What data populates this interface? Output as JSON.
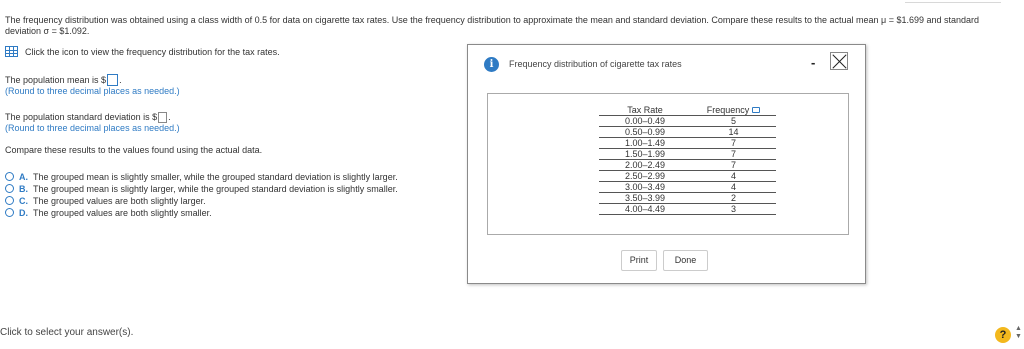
{
  "question": {
    "text": "The frequency distribution was obtained using a class width of 0.5 for data on cigarette tax rates. Use the frequency distribution to approximate the mean and standard deviation. Compare these results to the actual mean μ = $1.699 and standard deviation σ = $1.092."
  },
  "tool": {
    "label": "Click the icon to view the frequency distribution for the tax rates."
  },
  "part_mean": {
    "prefix": "The population mean is $",
    "suffix": ".",
    "hint": "(Round to three decimal places as needed.)"
  },
  "part_sd": {
    "prefix": "The population standard deviation is $",
    "suffix": ".",
    "hint": "(Round to three decimal places as needed.)"
  },
  "compare": {
    "text": "Compare these results to the values found using the actual data."
  },
  "choices": [
    {
      "letter": "A.",
      "text": "The grouped mean is slightly smaller, while the grouped standard deviation is slightly larger."
    },
    {
      "letter": "B.",
      "text": "The grouped mean is slightly larger, while the grouped standard deviation is slightly smaller."
    },
    {
      "letter": "C.",
      "text": "The grouped values are both slightly larger."
    },
    {
      "letter": "D.",
      "text": "The grouped values are both slightly smaller."
    }
  ],
  "footer": {
    "status": "Click to select your answer(s).",
    "help_symbol": "?",
    "arrows": "▲▼"
  },
  "modal": {
    "info_symbol": "i",
    "title": "Frequency distribution of cigarette tax rates",
    "minimize_symbol": "-",
    "table": {
      "headers": [
        "Tax Rate",
        "Frequency"
      ],
      "rows": [
        [
          "0.00–0.49",
          "5"
        ],
        [
          "0.50–0.99",
          "14"
        ],
        [
          "1.00–1.49",
          "7"
        ],
        [
          "1.50–1.99",
          "7"
        ],
        [
          "2.00–2.49",
          "7"
        ],
        [
          "2.50–2.99",
          "4"
        ],
        [
          "3.00–3.49",
          "4"
        ],
        [
          "3.50–3.99",
          "2"
        ],
        [
          "4.00–4.49",
          "3"
        ]
      ]
    },
    "buttons": {
      "print": "Print",
      "done": "Done"
    }
  },
  "colors": {
    "accent": "#2f7bc4",
    "help": "#f3b81d"
  },
  "icons": {
    "table": "table-icon",
    "info": "info-icon",
    "copy": "copy-icon",
    "help": "help-icon"
  }
}
